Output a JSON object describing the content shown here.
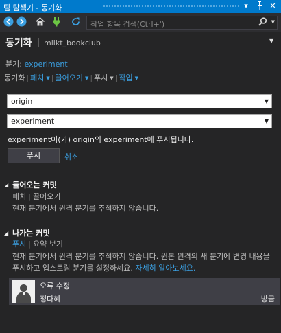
{
  "window": {
    "title": "팀 탐색기 - 동기화",
    "dropdown_glyph": "▾",
    "pin_glyph": "ꟸ",
    "close_glyph": "✕"
  },
  "toolbar": {
    "back_icon": "back-arrow-icon",
    "forward_icon": "forward-arrow-icon",
    "home_icon": "home-icon",
    "connect_icon": "plug-icon",
    "refresh_icon": "refresh-icon",
    "search_placeholder": "작업 항목 검색(Ctrl+')"
  },
  "page": {
    "title": "동기화",
    "separator": "|",
    "repo": "milkt_bookclub"
  },
  "branch": {
    "label": "분기:",
    "name": "experiment"
  },
  "nav": {
    "items": [
      {
        "label": "동기화",
        "is_link": false,
        "has_menu": false
      },
      {
        "label": "페치",
        "is_link": true,
        "has_menu": true
      },
      {
        "label": "끌어오기",
        "is_link": true,
        "has_menu": true
      },
      {
        "label": "푸시",
        "is_link": false,
        "has_menu": true
      },
      {
        "label": "작업",
        "is_link": true,
        "has_menu": true
      }
    ]
  },
  "push_form": {
    "remote": "origin",
    "branch": "experiment",
    "message": "experiment이(가) origin의 experiment에 푸시됩니다.",
    "push_button": "푸시",
    "cancel_link": "취소"
  },
  "incoming": {
    "title": "들어오는 커밋",
    "link_fetch": "페치",
    "link_pull": "끌어오기",
    "description": "현재 분기에서 원격 분기를 추적하지 않습니다."
  },
  "outgoing": {
    "title": "나가는 커밋",
    "link_push": "푸시",
    "link_view": "요약 보기",
    "description": "현재 분기에서 원격 분기를 추적하지 않습니다. 원본 원격의 새 분기에 변경 내용을 푸시하고 업스트림 분기를 설정하세요.",
    "learn_more": "자세히 알아보세요."
  },
  "commit": {
    "message": "오류 수정",
    "author": "정다혜",
    "time": "방금"
  },
  "colors": {
    "accent": "#007acc",
    "link": "#3b9fe0",
    "background": "#252526"
  }
}
